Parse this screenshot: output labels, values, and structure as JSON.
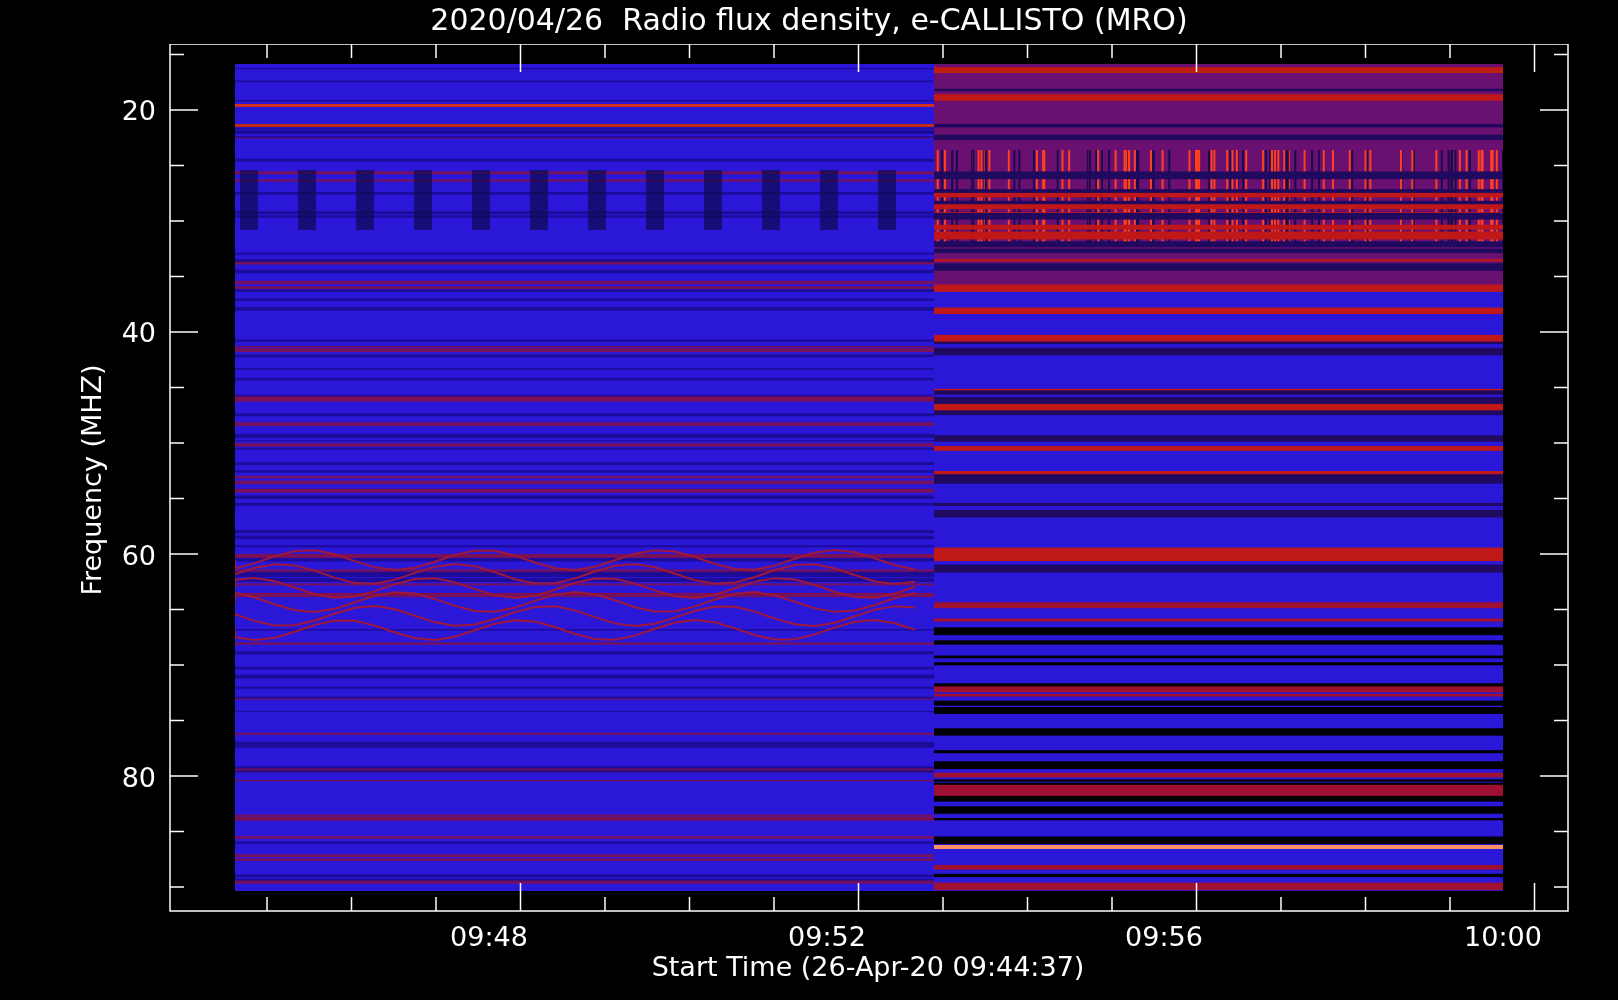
{
  "title": "2020/04/26  Radio flux density, e-CALLISTO (MRO)",
  "plot": {
    "ylabel": "Frequency (MHZ)",
    "xlabel": "Start Time (26-Apr-20 09:44:37)",
    "yticks": [
      "20",
      "40",
      "60",
      "80"
    ],
    "xticks": [
      "09:48",
      "09:52",
      "09:56",
      "10:00"
    ]
  }
}
